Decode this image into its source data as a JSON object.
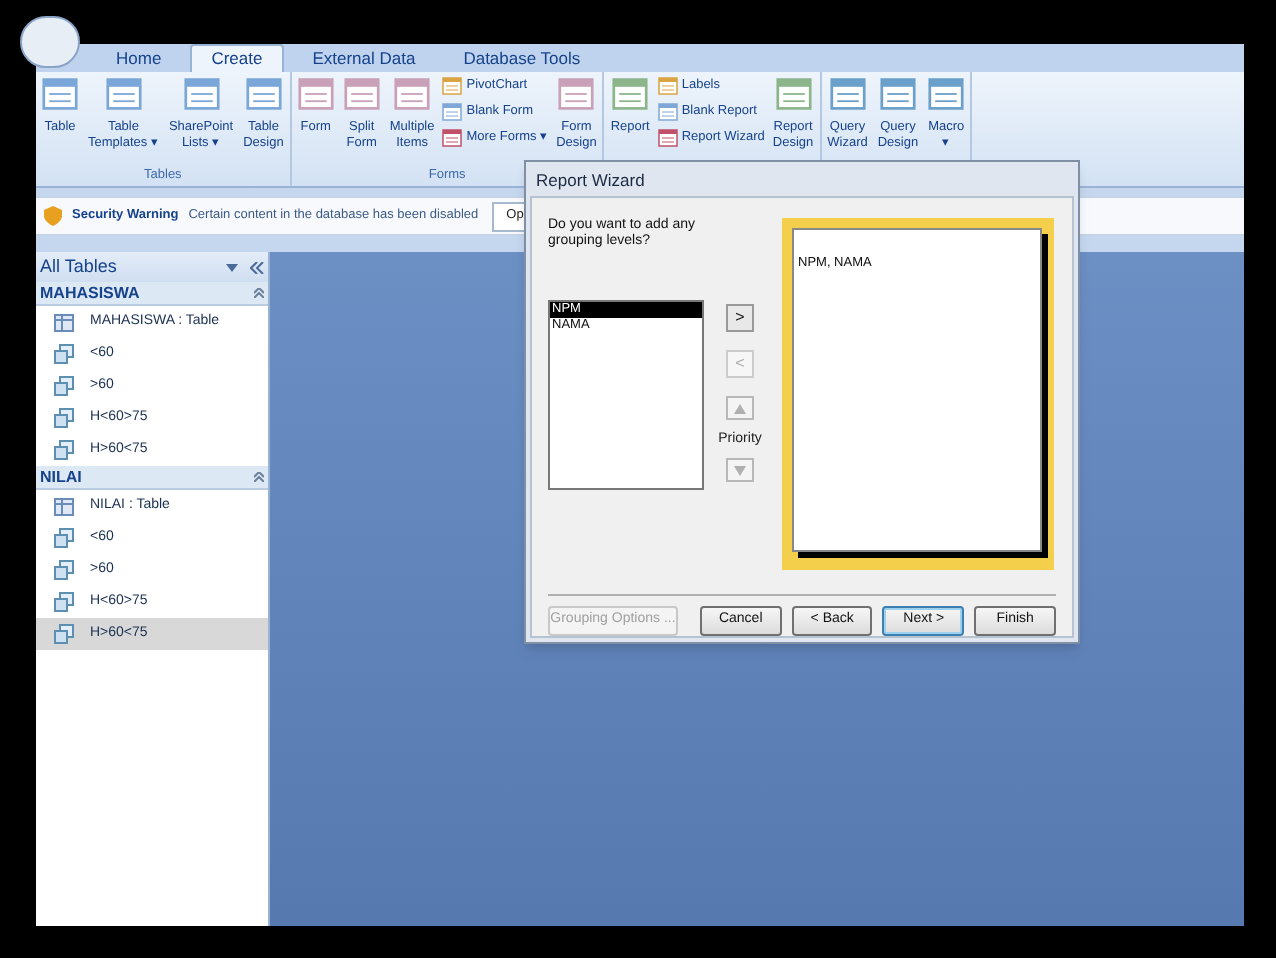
{
  "ribbon": {
    "tabs": [
      {
        "label": "Home",
        "selected": false
      },
      {
        "label": "Create",
        "selected": true
      },
      {
        "label": "External Data",
        "selected": false
      },
      {
        "label": "Database Tools",
        "selected": false
      }
    ],
    "groups": [
      {
        "label": "Tables",
        "items": [
          {
            "kind": "large",
            "lines": [
              "Table"
            ]
          },
          {
            "kind": "large",
            "lines": [
              "Table",
              "Templates ▾"
            ]
          },
          {
            "kind": "large",
            "lines": [
              "SharePoint",
              "Lists ▾"
            ]
          },
          {
            "kind": "large",
            "lines": [
              "Table",
              "Design"
            ]
          }
        ]
      },
      {
        "label": "Forms",
        "items": [
          {
            "kind": "large",
            "lines": [
              "Form"
            ]
          },
          {
            "kind": "large",
            "lines": [
              "Split",
              "Form"
            ]
          },
          {
            "kind": "large",
            "lines": [
              "Multiple",
              "Items"
            ]
          },
          {
            "kind": "small",
            "items": [
              {
                "label": "PivotChart"
              },
              {
                "label": "Blank Form"
              },
              {
                "label": "More Forms ▾"
              }
            ]
          },
          {
            "kind": "large",
            "lines": [
              "Form",
              "Design"
            ]
          }
        ]
      },
      {
        "items": [
          {
            "kind": "large",
            "lines": [
              "Report"
            ]
          },
          {
            "kind": "small",
            "items": [
              {
                "label": "Labels"
              },
              {
                "label": "Blank Report"
              },
              {
                "label": "Report Wizard"
              }
            ]
          },
          {
            "kind": "large",
            "lines": [
              "Report",
              "Design"
            ]
          }
        ]
      },
      {
        "items": [
          {
            "kind": "large",
            "lines": [
              "Query",
              "Wizard"
            ]
          },
          {
            "kind": "large",
            "lines": [
              "Query",
              "Design"
            ]
          },
          {
            "kind": "large",
            "lines": [
              "Macro",
              "▾"
            ]
          }
        ]
      }
    ]
  },
  "security_bar": {
    "title": "Security Warning",
    "message": "Certain content in the database has been disabled",
    "button": "Op"
  },
  "nav_pane": {
    "title": "All Tables",
    "groups": [
      {
        "label": "MAHASISWA",
        "items": [
          {
            "kind": "table",
            "label": "MAHASISWA : Table",
            "selected": false
          },
          {
            "kind": "query",
            "label": "<60",
            "selected": false
          },
          {
            "kind": "query",
            "label": ">60",
            "selected": false
          },
          {
            "kind": "query",
            "label": "H<60>75",
            "selected": false
          },
          {
            "kind": "query",
            "label": "H>60<75",
            "selected": false
          }
        ]
      },
      {
        "label": "NILAI",
        "items": [
          {
            "kind": "table",
            "label": "NILAI : Table",
            "selected": false
          },
          {
            "kind": "query",
            "label": "<60",
            "selected": false
          },
          {
            "kind": "query",
            "label": ">60",
            "selected": false
          },
          {
            "kind": "query",
            "label": "H<60>75",
            "selected": false
          },
          {
            "kind": "query",
            "label": "H>60<75",
            "selected": true
          }
        ]
      }
    ]
  },
  "dialog": {
    "title": "Report Wizard",
    "question": "Do you want to add any grouping levels?",
    "fields": [
      {
        "label": "NPM",
        "selected": true
      },
      {
        "label": "NAMA",
        "selected": false
      }
    ],
    "move_buttons": [
      {
        "label": ">",
        "disabled": false
      },
      {
        "label": "<",
        "disabled": true
      }
    ],
    "priority": {
      "label": "Priority",
      "up_disabled": true,
      "down_disabled": true
    },
    "preview": "NPM, NAMA",
    "buttons": [
      {
        "label": "Grouping Options ...",
        "disabled": true,
        "default": false
      },
      {
        "label": "Cancel",
        "disabled": false,
        "default": false
      },
      {
        "label": "< Back",
        "disabled": false,
        "default": false
      },
      {
        "label": "Next >",
        "disabled": false,
        "default": true
      },
      {
        "label": "Finish",
        "disabled": false,
        "default": false
      }
    ]
  }
}
